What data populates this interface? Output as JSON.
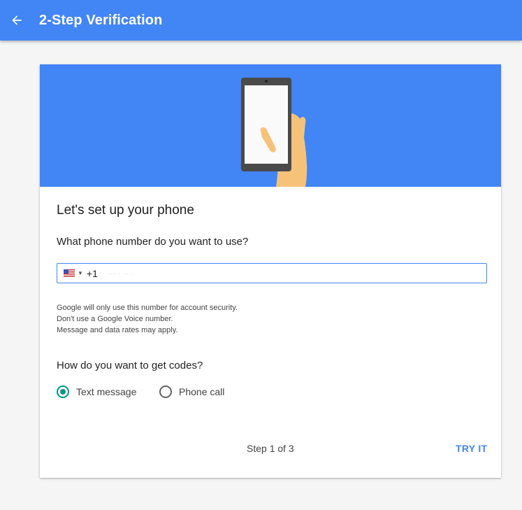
{
  "app_bar": {
    "title": "2-Step Verification",
    "back_icon": "arrow-back-icon",
    "color": "#4285f4"
  },
  "card": {
    "hero_illustration": "hand-holding-phone-illustration",
    "title": "Let's set up your phone",
    "phone_question": "What phone number do you want to use?",
    "phone_input": {
      "country_flag": "us-flag-icon",
      "value_prefix": "+1"
    },
    "notes": [
      "Google will only use this number for account security.",
      "Don't use a Google Voice number.",
      "Message and data rates may apply."
    ],
    "codes_question": "How do you want to get codes?",
    "options": [
      {
        "label": "Text message",
        "selected": true
      },
      {
        "label": "Phone call",
        "selected": false
      }
    ],
    "step": "Step 1 of 3",
    "try_button": "TRY IT"
  },
  "colors": {
    "accent": "#4285f4",
    "radio_selected": "#009688",
    "background": "#f5f5f5"
  }
}
